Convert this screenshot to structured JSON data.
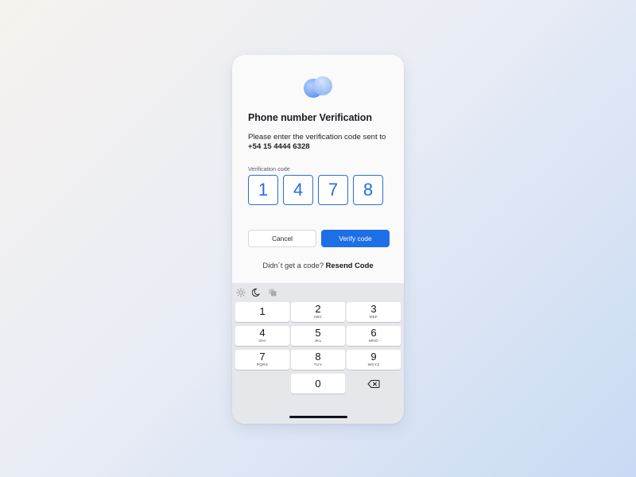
{
  "screen": {
    "title": "Phone number Verification",
    "subtitle": "Please enter the verification code sent to",
    "phone_number": "+54 15 4444 6328",
    "code_label": "Verification code",
    "code_digits": [
      "1",
      "4",
      "7",
      "8"
    ]
  },
  "actions": {
    "cancel_label": "Cancel",
    "verify_label": "Verify code"
  },
  "resend": {
    "prompt": "Didn´t get a code?",
    "link_label": "Resend Code"
  },
  "keyboard": {
    "toolbar_icons": [
      "sun-icon",
      "moon-icon",
      "copy-icon"
    ],
    "keys": [
      {
        "digit": "1",
        "letters": ""
      },
      {
        "digit": "2",
        "letters": "ABC"
      },
      {
        "digit": "3",
        "letters": "DEF"
      },
      {
        "digit": "4",
        "letters": "GHI"
      },
      {
        "digit": "5",
        "letters": "JKL"
      },
      {
        "digit": "6",
        "letters": "MNO"
      },
      {
        "digit": "7",
        "letters": "PQRS"
      },
      {
        "digit": "8",
        "letters": "TUV"
      },
      {
        "digit": "9",
        "letters": "WXYZ"
      },
      {
        "digit": "0",
        "letters": ""
      }
    ]
  },
  "colors": {
    "accent": "#1d6fe8",
    "code_border": "#2b6fd6",
    "keyboard_bg": "#e6e7ea"
  }
}
